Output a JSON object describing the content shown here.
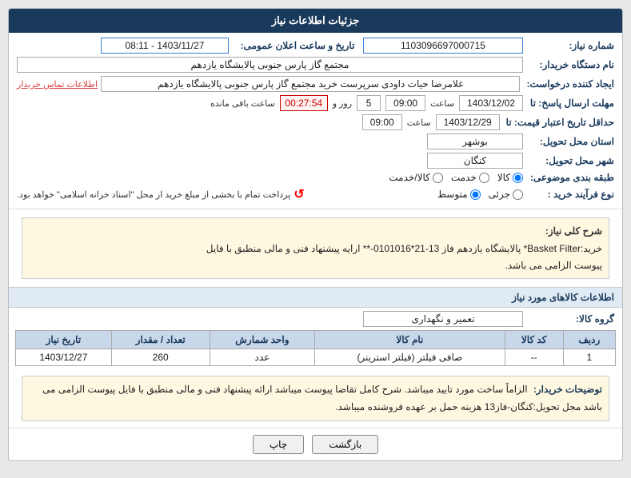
{
  "header": {
    "title": "جزئیات اطلاعات نیاز"
  },
  "fields": {
    "shomare_niaz_label": "شماره نیاز:",
    "shomare_niaz_value": "1103096697000715",
    "tarikh_label": "تاریخ و ساعت اعلان عمومی:",
    "tarikh_value": "1403/11/27 - 08:11",
    "name_dastgah_label": "نام دستگاه خریدار:",
    "name_dastgah_value": "مجتمع گاز پارس جنوبی  پالایشگاه یازدهم",
    "ijad_label": "ایجاد کننده درخواست:",
    "ijad_value": "غلامرضا حیات داودی سرپرست خرید مجتمع گاز پارس جنوبی  پالایشگاه یازدهم",
    "ettelaat_btn": "اطلاعات تماس خریدار",
    "mohlat_label": "مهلت ارسال پاسخ: تا",
    "mohlat_date": "1403/12/02",
    "mohlat_saat": "09:00",
    "mohlat_saat_label": "ساعت",
    "mohlat_roz": "5",
    "mohlat_roz_label": "روز و",
    "mohlat_mande": "00:27:54",
    "mohlat_mande_label": "ساعت باقی مانده",
    "hadaghol_label": "حداقل تاریخ اعتبار قیمت: تا",
    "hadaghol_date": "1403/12/29",
    "hadaghol_saat": "09:00",
    "hadaghol_saat_label": "ساعت",
    "ostan_label": "استان محل تحویل:",
    "ostan_value": "بوشهر",
    "shahr_label": "شهر محل تحویل:",
    "shahr_value": "کنگان",
    "tabaghe_label": "طبقه بندی موضوعی:",
    "tabaghe_options": [
      "کالا",
      "خدمت",
      "کالا/خدمت"
    ],
    "tabaghe_selected": "کالا",
    "nov_label": "نوع فرآیند خرید :",
    "nov_options": [
      "جزئی",
      "متوسط"
    ],
    "nov_selected": "متوسط",
    "nov_note": "پرداخت تمام با بخشی از مبلغ خرید از محل \"اسناد خزانه اسلامی\" خواهد بود.",
    "shrj_label": "شرح کلی نیاز:",
    "shrj_text_line1": "خرید:Basket Filter* پالایشگاه یازدهم فاز 13-21*0101016-** ارایه پیشنهاد فنی و مالی منطبق با فایل",
    "shrj_text_line2": "پیوست الزامی می باشد.",
    "info_header": "اطلاعات کالاهای مورد نیاز",
    "group_label": "گروه کالا:",
    "group_value": "تعمیر و نگهداری",
    "table": {
      "headers": [
        "ردیف",
        "کد کالا",
        "نام کالا",
        "واحد شمارش",
        "تعداد / مقدار",
        "تاریخ نیاز"
      ],
      "rows": [
        {
          "radif": "1",
          "kod": "--",
          "name": "صافی فیلتر (فیلتر استرینر)",
          "vahed": "عدد",
          "tedad": "260",
          "tarikh": "1403/12/27"
        }
      ]
    },
    "notes_label": "توضیحات خریدار:",
    "notes_text": "الزاماً ساخت مورد تایید میباشد. شرح کامل تقاضا پیوست میباشد ارائه پیشنهاد فنی و مالی منطبق با فایل پیوست الزامی می باشد مجل تحویل:کنگان-فاز13 هزینه حمل بر عهده فروشنده میباشد.",
    "btn_print": "چاپ",
    "btn_back": "بازگشت"
  }
}
